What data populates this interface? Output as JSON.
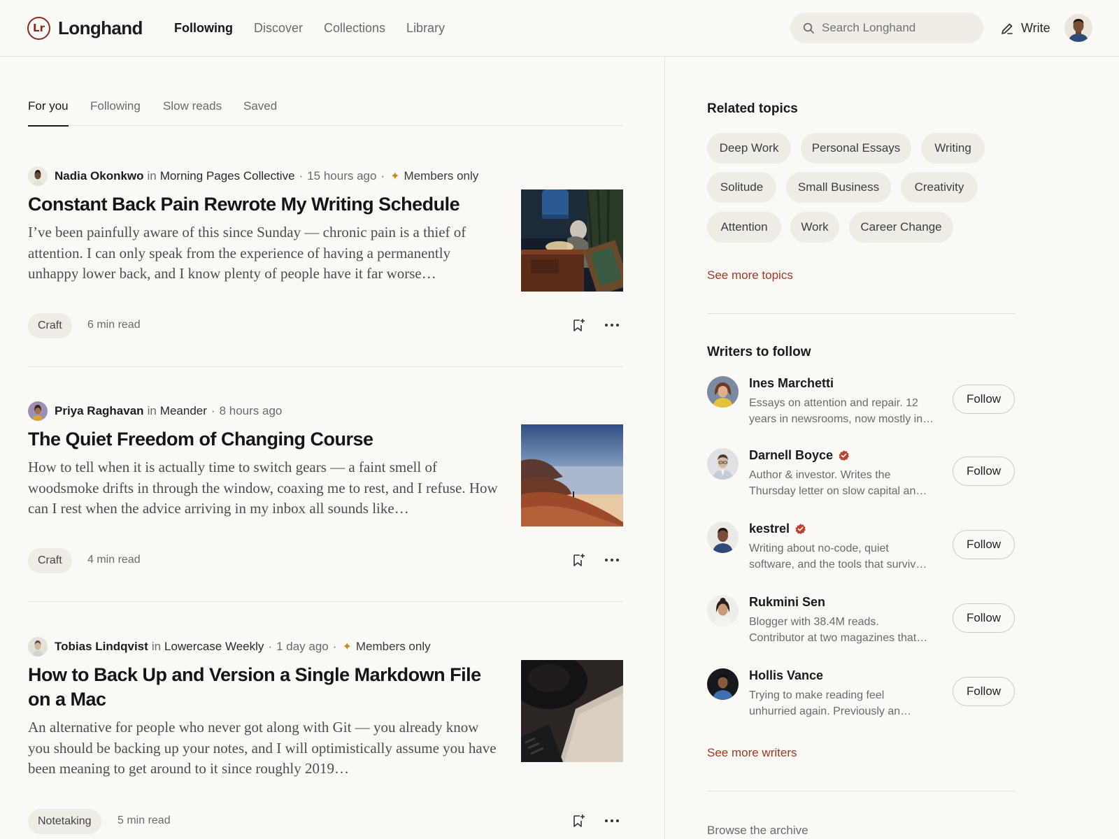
{
  "app": {
    "logo_text": "Longhand",
    "logo_mark": "Lr",
    "brand_color": "#8d2a1f",
    "link_color": "#9a3a22",
    "accent_star_color": "#c98a25"
  },
  "header": {
    "nav": [
      "Following",
      "Discover",
      "Collections",
      "Library"
    ],
    "active_nav": "Following",
    "search_placeholder": "Search Longhand",
    "write_label": "Write",
    "icons": {
      "search": "search-icon",
      "write": "pencil-icon"
    }
  },
  "tabs": {
    "items": [
      "For you",
      "Following",
      "Slow reads",
      "Saved"
    ],
    "active": "For you"
  },
  "articles": [
    {
      "author": "Nadia Okonkwo",
      "in": "in",
      "publication": "Morning Pages Collective",
      "time": "15 hours ago",
      "members_only": "Members only",
      "title": "Constant Back Pain Rewrote My Writing Schedule",
      "excerpt": "I’ve been painfully aware of this since Sunday — chronic pain is a thief of attention. I can only speak from the experience of having a permanently unhappy lower back, and I know plenty of people have it far worse…",
      "tag": "Craft",
      "read_time": "6 min read"
    },
    {
      "author": "Priya Raghavan",
      "in": "in",
      "publication": "Meander",
      "time": "8 hours ago",
      "members_only": "",
      "title": "The Quiet Freedom of Changing Course",
      "excerpt": "How to tell when it is actually time to switch gears — a faint smell of woodsmoke drifts in through the window, coaxing me to rest, and I refuse. How can I rest when the advice arriving in my inbox all sounds like…",
      "tag": "Craft",
      "read_time": "4 min read"
    },
    {
      "author": "Tobias Lindqvist",
      "in": "in",
      "publication": "Lowercase Weekly",
      "time": "1 day ago",
      "members_only": "Members only",
      "title": "How to Back Up and Version a Single Markdown File on a Mac",
      "excerpt": "An alternative for people who never got along with Git — you already know you should be backing up your notes, and I will optimistically assume you have been meaning to get around to it since roughly 2019…",
      "tag": "Notetaking",
      "read_time": "5 min read"
    }
  ],
  "sidebar": {
    "related_title": "Related topics",
    "topics": [
      "Deep Work",
      "Personal Essays",
      "Writing",
      "Solitude",
      "Small Business",
      "Creativity",
      "Attention",
      "Work",
      "Career Change"
    ],
    "see_more_topics": "See more topics",
    "writers_title": "Writers to follow",
    "follow_label": "Follow",
    "writers": [
      {
        "name": "Ines Marchetti",
        "verified": false,
        "bio_line1": "Essays on attention and repair. 12",
        "bio_line2": "years in newsrooms, now mostly in…"
      },
      {
        "name": "Darnell Boyce",
        "verified": true,
        "bio_line1": "Author & investor. Writes the",
        "bio_line2": "Thursday letter on slow capital an…"
      },
      {
        "name": "kestrel",
        "verified": true,
        "bio_line1": "Writing about no-code, quiet",
        "bio_line2": "software, and the tools that surviv…"
      },
      {
        "name": "Rukmini Sen",
        "verified": false,
        "bio_line1": "Blogger with 38.4M reads.",
        "bio_line2": "Contributor at two magazines that…"
      },
      {
        "name": "Hollis Vance",
        "verified": false,
        "bio_line1": "Trying to make reading feel",
        "bio_line2": "unhurried again. Previously an…"
      }
    ],
    "see_more_writers": "See more writers",
    "browse_archive": "Browse the archive"
  }
}
